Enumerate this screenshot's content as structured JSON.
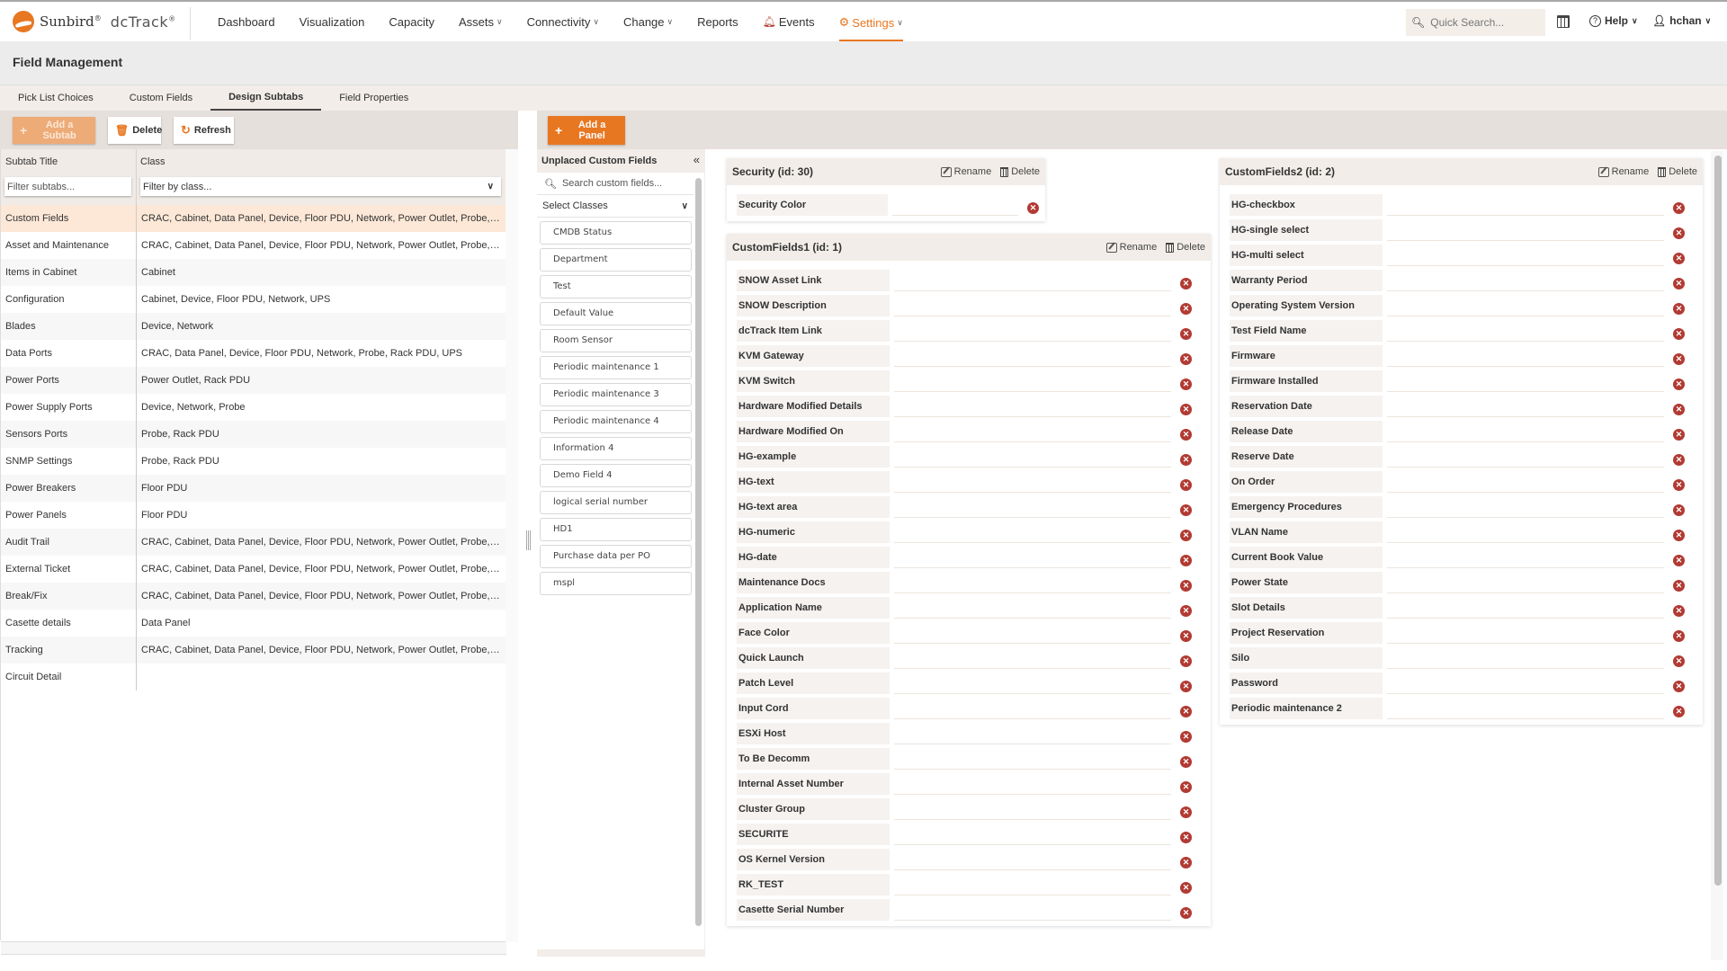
{
  "app": {
    "brand": "Sunbird",
    "product": "dcTrack",
    "registered": "®"
  },
  "nav": {
    "items": [
      {
        "label": "Dashboard",
        "dropdown": false
      },
      {
        "label": "Visualization",
        "dropdown": false
      },
      {
        "label": "Capacity",
        "dropdown": false
      },
      {
        "label": "Assets",
        "dropdown": true
      },
      {
        "label": "Connectivity",
        "dropdown": true
      },
      {
        "label": "Change",
        "dropdown": true
      },
      {
        "label": "Reports",
        "dropdown": false
      },
      {
        "label": "Events",
        "dropdown": false,
        "icon": "bell-icon"
      },
      {
        "label": "Settings",
        "dropdown": true,
        "icon": "gear-icon",
        "active": true
      }
    ],
    "quick_search_placeholder": "Quick Search...",
    "help_label": "Help",
    "user_label": "hchan"
  },
  "page": {
    "title": "Field Management"
  },
  "tabs": [
    {
      "label": "Pick List Choices",
      "active": false
    },
    {
      "label": "Custom Fields",
      "active": false
    },
    {
      "label": "Design Subtabs",
      "active": true
    },
    {
      "label": "Field Properties",
      "active": false
    }
  ],
  "left_toolbar": {
    "add_subtab": "Add a Subtab",
    "delete": "Delete",
    "refresh": "Refresh"
  },
  "subtab_table": {
    "columns": [
      "Subtab Title",
      "Class"
    ],
    "filter_title_placeholder": "Filter subtabs...",
    "filter_class_placeholder": "Filter by class...",
    "rows": [
      {
        "title": "Custom Fields",
        "class": "CRAC, Cabinet, Data Panel, Device, Floor PDU, Network, Power Outlet, Probe, Rac...",
        "selected": true
      },
      {
        "title": "Asset and Maintenance",
        "class": "CRAC, Cabinet, Data Panel, Device, Floor PDU, Network, Power Outlet, Probe, Rac..."
      },
      {
        "title": "Items in Cabinet",
        "class": "Cabinet"
      },
      {
        "title": "Configuration",
        "class": "Cabinet, Device, Floor PDU, Network, UPS"
      },
      {
        "title": "Blades",
        "class": "Device, Network"
      },
      {
        "title": "Data Ports",
        "class": "CRAC, Data Panel, Device, Floor PDU, Network, Probe, Rack PDU, UPS"
      },
      {
        "title": "Power Ports",
        "class": "Power Outlet, Rack PDU"
      },
      {
        "title": "Power Supply Ports",
        "class": "Device, Network, Probe"
      },
      {
        "title": "Sensors Ports",
        "class": "Probe, Rack PDU"
      },
      {
        "title": "SNMP Settings",
        "class": "Probe, Rack PDU"
      },
      {
        "title": "Power Breakers",
        "class": "Floor PDU"
      },
      {
        "title": "Power Panels",
        "class": "Floor PDU"
      },
      {
        "title": "Audit Trail",
        "class": "CRAC, Cabinet, Data Panel, Device, Floor PDU, Network, Power Outlet, Probe, Rac..."
      },
      {
        "title": "External Ticket",
        "class": "CRAC, Cabinet, Data Panel, Device, Floor PDU, Network, Power Outlet, Probe, Rac..."
      },
      {
        "title": "Break/Fix",
        "class": "CRAC, Cabinet, Data Panel, Device, Floor PDU, Network, Power Outlet, Probe, Rac..."
      },
      {
        "title": "Casette details",
        "class": "Data Panel"
      },
      {
        "title": "Tracking",
        "class": "CRAC, Cabinet, Data Panel, Device, Floor PDU, Network, Power Outlet, Probe, Rac..."
      },
      {
        "title": "Circuit Detail",
        "class": ""
      }
    ]
  },
  "right_toolbar": {
    "add_panel": "Add a Panel"
  },
  "unplaced": {
    "title": "Unplaced Custom Fields",
    "search_placeholder": "Search custom fields...",
    "select_classes": "Select Classes",
    "items": [
      "CMDB Status",
      "Department",
      "Test",
      "Default Value",
      "Room Sensor",
      "Periodic maintenance 1",
      "Periodic maintenance 3",
      "Periodic maintenance 4",
      "Information 4",
      "Demo Field 4",
      "logical serial number",
      "HD1",
      "Purchase data per PO",
      "mspl"
    ]
  },
  "panels": {
    "rename_label": "Rename",
    "delete_label": "Delete",
    "security": {
      "title": "Security (id: 30)",
      "fields": [
        "Security Color"
      ]
    },
    "cf1": {
      "title": "CustomFields1 (id: 1)",
      "fields": [
        "SNOW Asset Link",
        "SNOW Description",
        "dcTrack Item Link",
        "KVM Gateway",
        "KVM Switch",
        "Hardware Modified Details",
        "Hardware Modified On",
        "HG-example",
        "HG-text",
        "HG-text area",
        "HG-numeric",
        "HG-date",
        "Maintenance Docs",
        "Application Name",
        "Face Color",
        "Quick Launch",
        "Patch Level",
        "Input Cord",
        "ESXi Host",
        "To Be Decomm",
        "Internal Asset Number",
        "Cluster Group",
        "SECURITE",
        "OS Kernel Version",
        "RK_TEST",
        "Casette Serial Number"
      ]
    },
    "cf2": {
      "title": "CustomFields2 (id: 2)",
      "fields": [
        "HG-checkbox",
        "HG-single select",
        "HG-multi select",
        "Warranty Period",
        "Operating System Version",
        "Test Field Name",
        "Firmware",
        "Firmware Installed",
        "Reservation Date",
        "Release Date",
        "Reserve Date",
        "On Order",
        "Emergency Procedures",
        "VLAN Name",
        "Current Book Value",
        "Power State",
        "Slot Details",
        "Project Reservation",
        "Silo",
        "Password",
        "Periodic maintenance 2"
      ]
    }
  },
  "colors": {
    "accent": "#e87722",
    "remove": "#b23a33",
    "selected_row": "#fde8d7"
  }
}
